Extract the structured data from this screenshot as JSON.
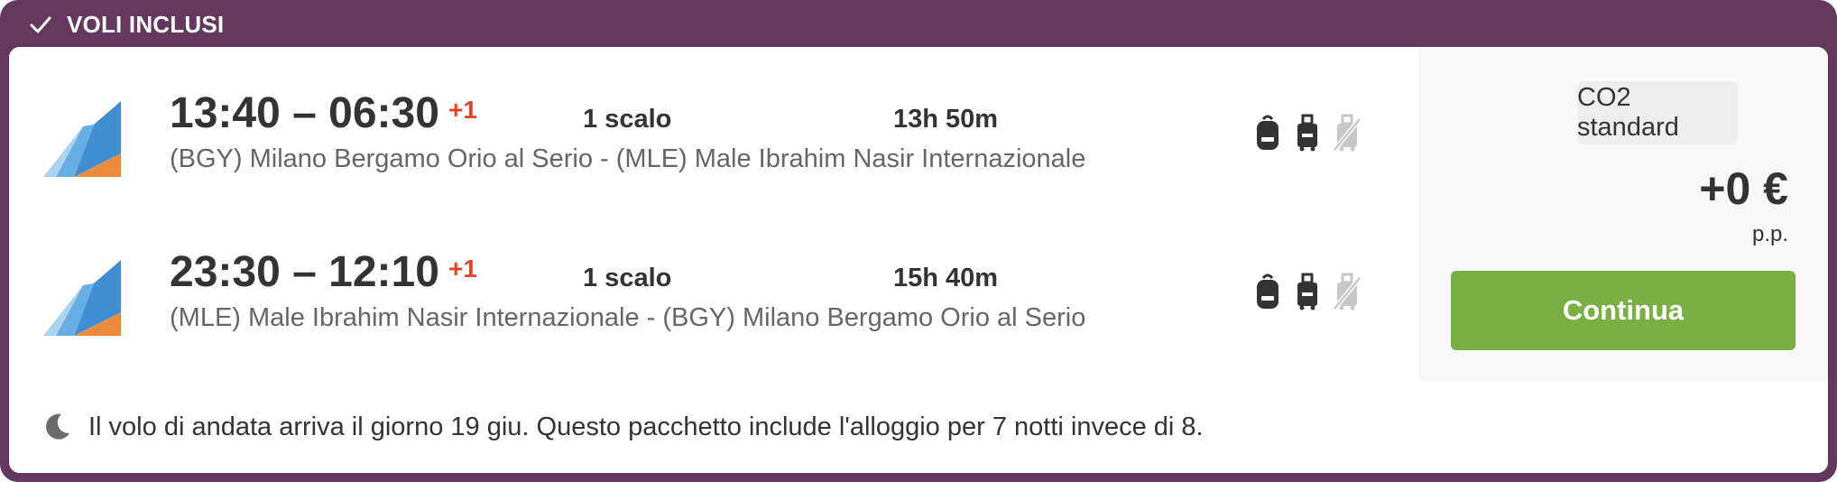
{
  "header": {
    "title": "VOLI INCLUSI",
    "icon": "check-icon"
  },
  "legs": [
    {
      "depart": "13:40",
      "arrive": "06:30",
      "day_offset": "+1",
      "stops": "1 scalo",
      "duration": "13h 50m",
      "route": "(BGY) Milano Bergamo Orio al Serio - (MLE) Male Ibrahim Nasir Internazionale",
      "baggage": [
        "backpack-icon",
        "trolley-icon",
        "checked-bag-not-included-icon"
      ]
    },
    {
      "depart": "23:30",
      "arrive": "12:10",
      "day_offset": "+1",
      "stops": "1 scalo",
      "duration": "15h 40m",
      "route": "(MLE) Male Ibrahim Nasir Internazionale - (BGY) Milano Bergamo Orio al Serio",
      "baggage": [
        "backpack-icon",
        "trolley-icon",
        "checked-bag-not-included-icon"
      ]
    }
  ],
  "time_separator": "–",
  "side": {
    "co2_label": "CO2 standard",
    "price": "+0 €",
    "per_person": "p.p.",
    "continue_label": "Continua"
  },
  "footer": {
    "note": "Il volo di andata arriva il giorno 19 giu. Questo pacchetto include l'alloggio per 7 notti invece di 8.",
    "icon": "moon-icon"
  },
  "colors": {
    "frame": "#64375f",
    "accent_green": "#7ab043",
    "day_offset": "#e0452b",
    "muted_text": "#666666"
  }
}
